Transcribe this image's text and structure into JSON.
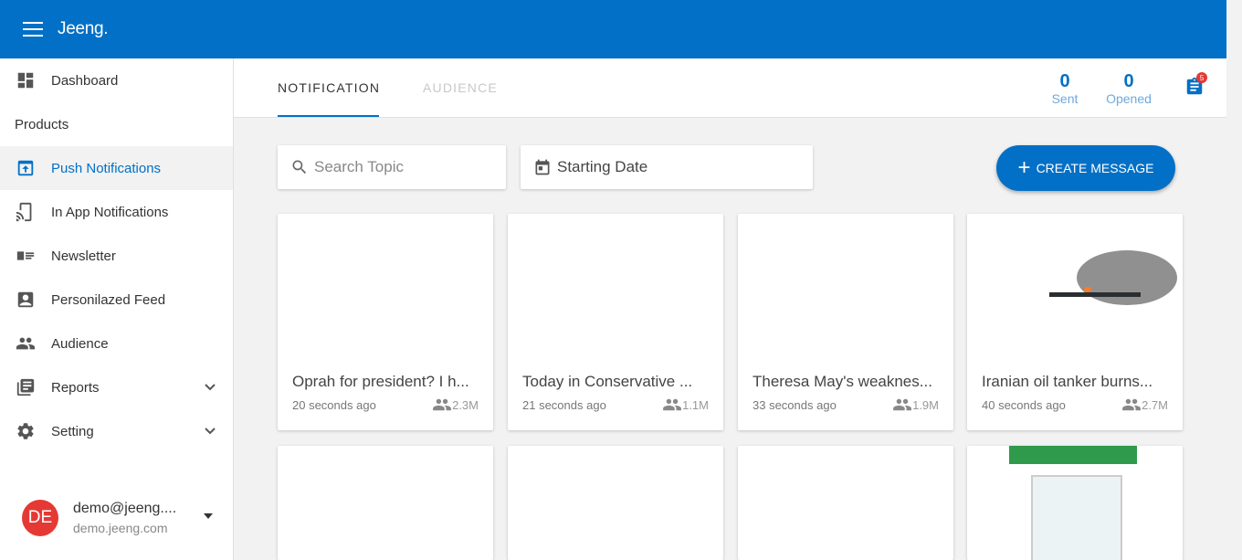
{
  "app": {
    "brand": "Jeeng."
  },
  "sidebar": {
    "items": [
      {
        "label": "Dashboard",
        "icon": "dashboard-icon"
      },
      {
        "label": "Products",
        "header": true
      },
      {
        "label": "Push Notifications",
        "icon": "push-icon",
        "active": true
      },
      {
        "label": "In App Notifications",
        "icon": "cast-icon"
      },
      {
        "label": "Newsletter",
        "icon": "newsletter-icon"
      },
      {
        "label": "Personilazed Feed",
        "icon": "feed-icon"
      },
      {
        "label": "Audience",
        "icon": "people-icon"
      },
      {
        "label": "Reports",
        "icon": "reports-icon",
        "expandable": true
      },
      {
        "label": "Setting",
        "icon": "gear-icon",
        "expandable": true
      }
    ],
    "user": {
      "initials": "DE",
      "email": "demo@jeeng....",
      "domain": "demo.jeeng.com"
    }
  },
  "tabs": [
    {
      "label": "NOTIFICATION",
      "active": true
    },
    {
      "label": "AUDIENCE",
      "active": false
    }
  ],
  "stats": {
    "sent": {
      "value": "0",
      "label": "Sent"
    },
    "opened": {
      "value": "0",
      "label": "Opened"
    },
    "badge": "5"
  },
  "filters": {
    "search_placeholder": "Search Topic",
    "date_label": "Starting Date",
    "create_label": "CREATE MESSAGE"
  },
  "cards": [
    {
      "title": "Oprah for president? I h...",
      "time": "20 seconds ago",
      "audience": "2.3M",
      "image": "none"
    },
    {
      "title": "Today in Conservative ...",
      "time": "21 seconds ago",
      "audience": "1.1M",
      "image": "none"
    },
    {
      "title": "Theresa May's weaknes...",
      "time": "33 seconds ago",
      "audience": "1.9M",
      "image": "none"
    },
    {
      "title": "Iranian oil tanker burns...",
      "time": "40 seconds ago",
      "audience": "2.7M",
      "image": "sea"
    }
  ],
  "colors": {
    "primary": "#0270c6",
    "avatar": "#e53935",
    "badge": "#e53935"
  }
}
